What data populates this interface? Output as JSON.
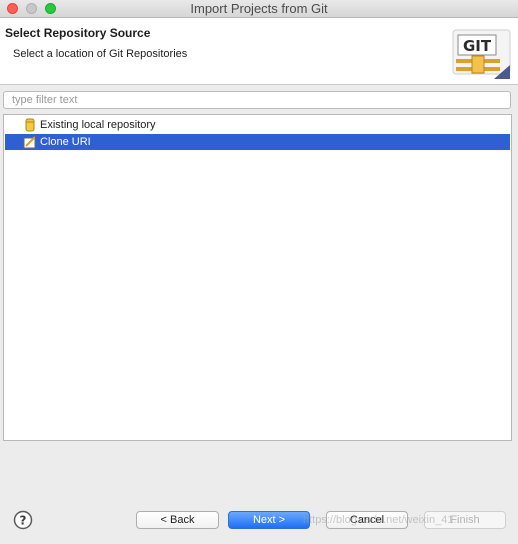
{
  "window": {
    "title": "Import Projects from Git"
  },
  "header": {
    "title": "Select Repository Source",
    "description": "Select a location of Git Repositories",
    "logo_text": "GIT"
  },
  "filter": {
    "placeholder": "type filter text",
    "value": ""
  },
  "sources": [
    {
      "label": "Existing local repository",
      "icon": "repository-icon",
      "selected": false
    },
    {
      "label": "Clone URI",
      "icon": "clone-uri-icon",
      "selected": true
    }
  ],
  "buttons": {
    "back": "< Back",
    "next": "Next >",
    "cancel": "Cancel",
    "finish": "Finish"
  },
  "watermark": "https://blog.csdn.net/weixin_41..."
}
